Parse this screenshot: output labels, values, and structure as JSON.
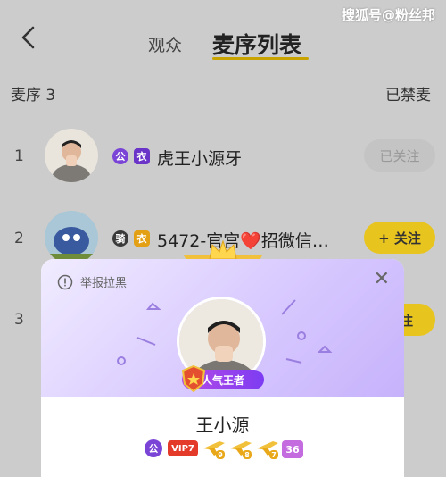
{
  "watermark": "搜狐号@粉丝邦",
  "header": {
    "tab_audience": "观众",
    "tab_queue": "麦序列表"
  },
  "section": {
    "title": "麦序 3",
    "muted_label": "已禁麦"
  },
  "rows": [
    {
      "num": "1",
      "badge_gong": "公",
      "badge_shirt": "衣",
      "name": "虎王小源牙",
      "action": "已关注"
    },
    {
      "num": "2",
      "badge_ride": "骑",
      "badge_shirt": "衣",
      "name": "5472-官宫",
      "heart": "❤️",
      "name2": "招微信…",
      "action": "+ 关注"
    },
    {
      "num": "3",
      "action": "关注"
    }
  ],
  "card": {
    "report": "举报拉黑",
    "close": "✕",
    "title_badge": "人气王者",
    "name": "王小源",
    "badge_gong": "公",
    "vip": "VIP7",
    "lvl1": "9",
    "lvl2": "8",
    "lvl3": "7",
    "lvl4": "36"
  },
  "colors": {
    "accent": "#e8c41e",
    "purple": "#7d3cf2"
  }
}
